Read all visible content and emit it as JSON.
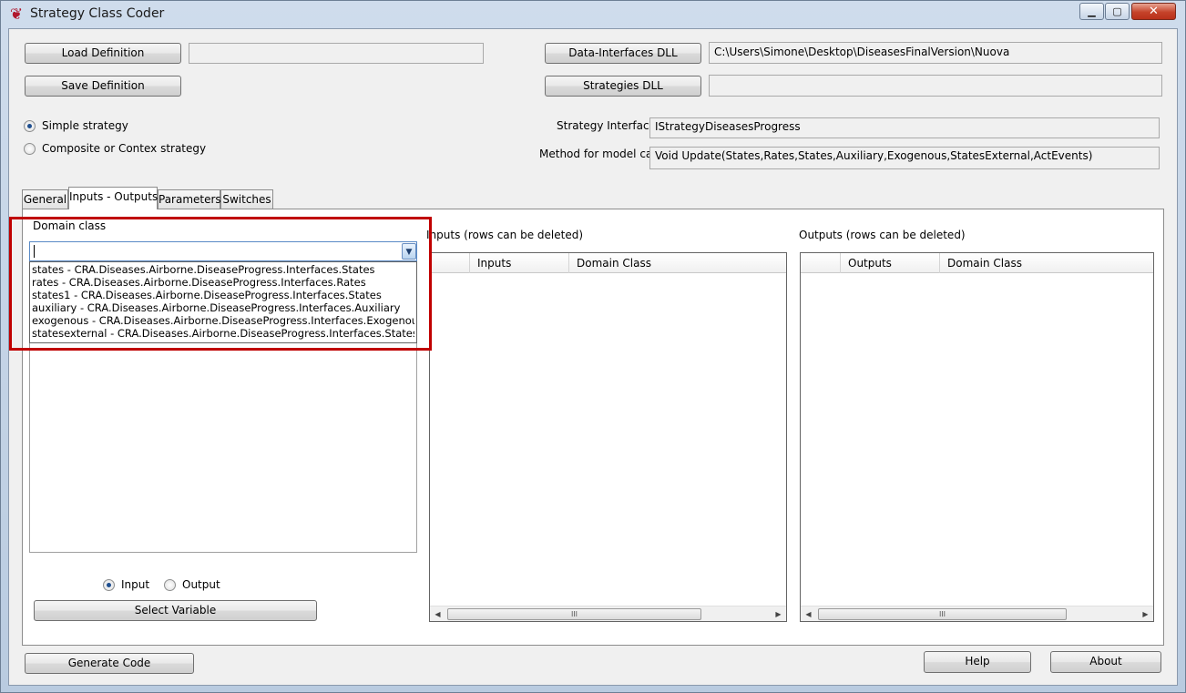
{
  "window": {
    "title": "Strategy Class Coder",
    "controls": {
      "minimize": "▁",
      "maximize": "▢",
      "close": "✕"
    }
  },
  "icons": {
    "app": "app-logo-icon",
    "dropdown": "chevron-down-icon",
    "scroll_left": "arrow-left-icon",
    "scroll_right": "arrow-right-icon"
  },
  "top": {
    "load_definition": "Load Definition",
    "load_definition_path": "",
    "save_definition": "Save Definition",
    "data_interfaces_dll": "Data-Interfaces DLL",
    "data_interfaces_path": "C:\\Users\\Simone\\Desktop\\DiseasesFinalVersion\\Nuova",
    "strategies_dll": "Strategies DLL",
    "strategies_path": ""
  },
  "strategy_type": {
    "options": [
      "Simple strategy",
      "Composite or Contex strategy"
    ],
    "selected": "Simple strategy"
  },
  "strategy_interface": {
    "label": "Strategy Interface",
    "value": "IStrategyDiseasesProgress"
  },
  "method_call": {
    "label": "Method for model call",
    "value": "Void Update(States,Rates,States,Auxiliary,Exogenous,StatesExternal,ActEvents)"
  },
  "tabs": [
    {
      "label": "General"
    },
    {
      "label": "Inputs - Outputs"
    },
    {
      "label": "Parameters"
    },
    {
      "label": "Switches"
    }
  ],
  "active_tab": "Inputs - Outputs",
  "domain_class": {
    "label": "Domain class",
    "value": "",
    "options": [
      "states - CRA.Diseases.Airborne.DiseaseProgress.Interfaces.States",
      "rates - CRA.Diseases.Airborne.DiseaseProgress.Interfaces.Rates",
      "states1 - CRA.Diseases.Airborne.DiseaseProgress.Interfaces.States",
      "auxiliary - CRA.Diseases.Airborne.DiseaseProgress.Interfaces.Auxiliary",
      "exogenous - CRA.Diseases.Airborne.DiseaseProgress.Interfaces.Exogenous",
      "statesexternal - CRA.Diseases.Airborne.DiseaseProgress.Interfaces.StatesExternal"
    ]
  },
  "io_mode": {
    "options": [
      "Input",
      "Output"
    ],
    "selected": "Input"
  },
  "select_variable": "Select Variable",
  "inputs_grid": {
    "caption": "Inputs (rows can be deleted)",
    "columns": [
      "",
      "Inputs",
      "Domain Class"
    ]
  },
  "outputs_grid": {
    "caption": "Outputs (rows can be deleted)",
    "columns": [
      "",
      "Outputs",
      "Domain Class"
    ]
  },
  "scroll_thumb_grip": "III",
  "bottom": {
    "generate_code": "Generate Code",
    "help": "Help",
    "about": "About"
  }
}
